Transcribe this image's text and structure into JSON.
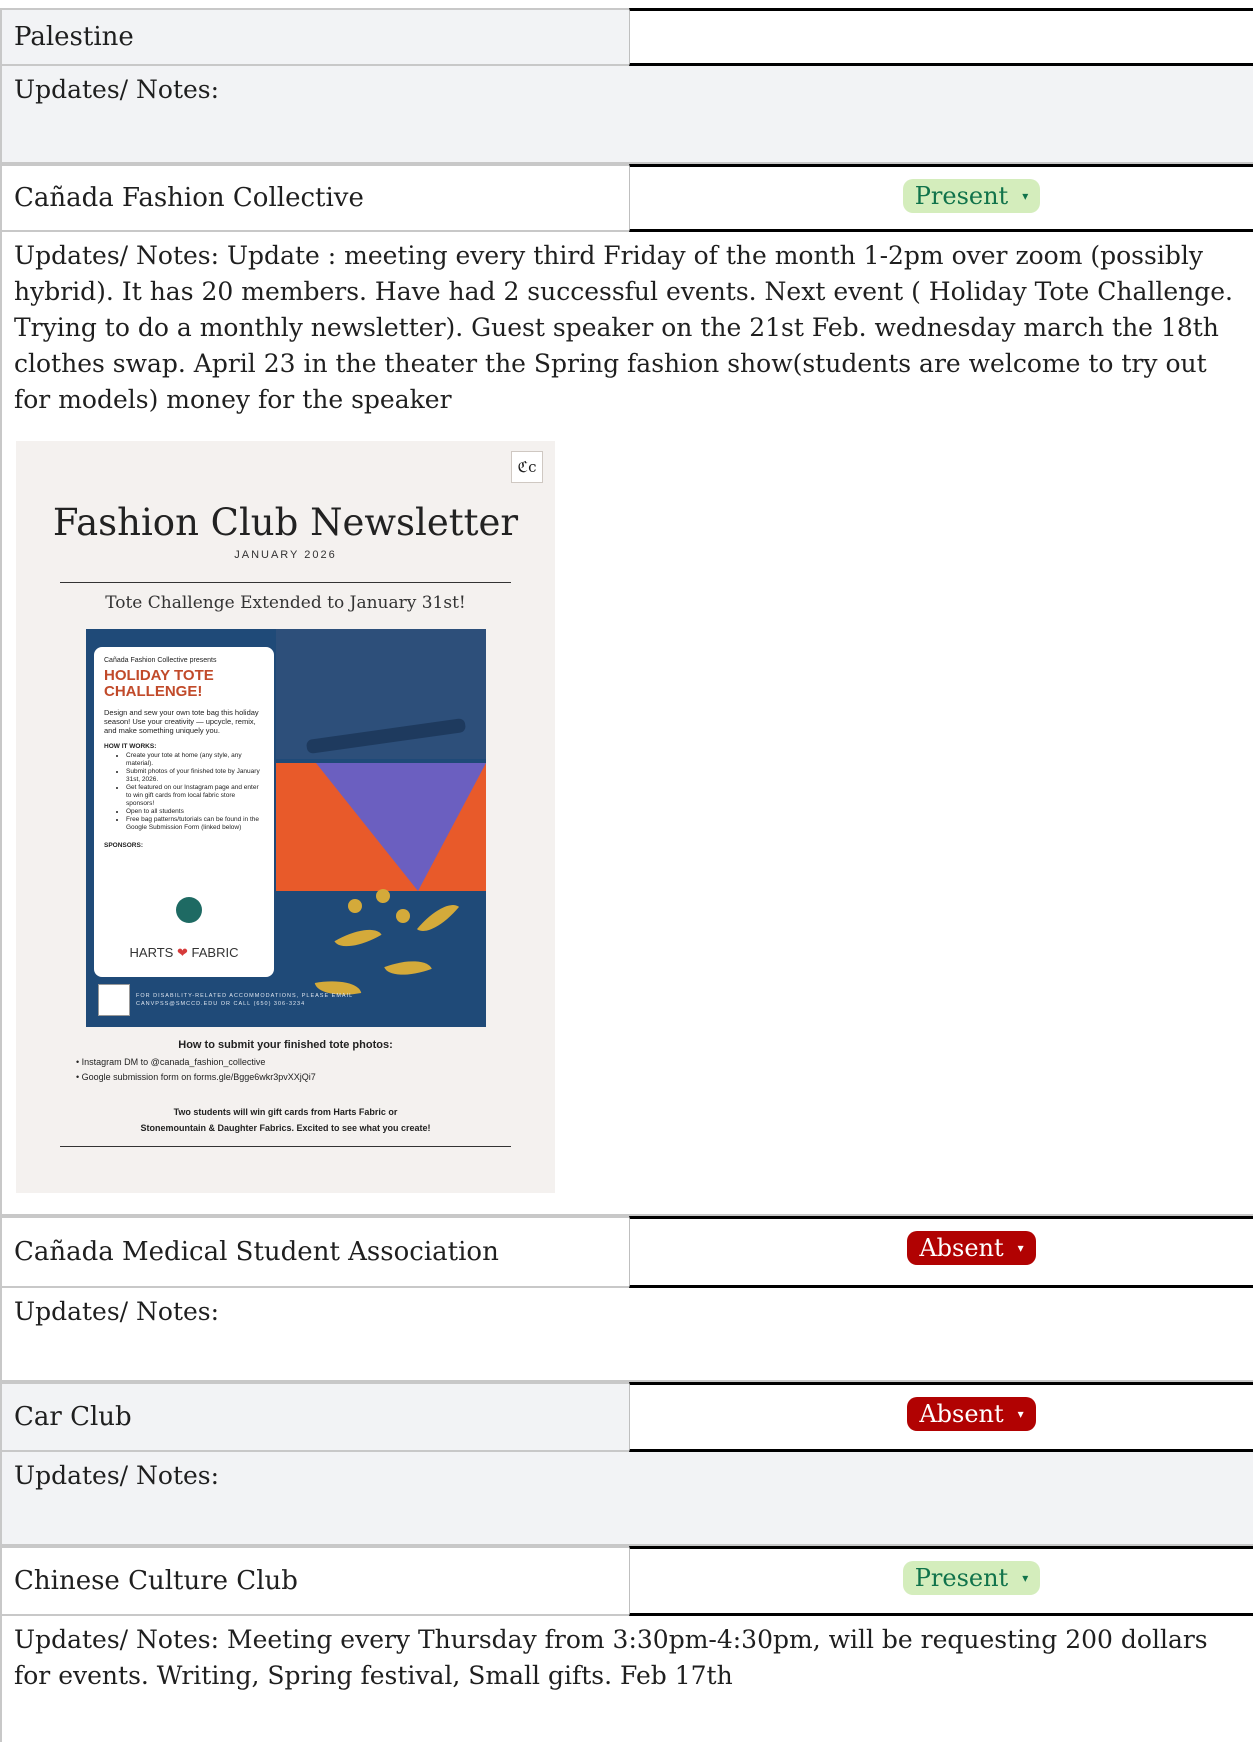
{
  "rows": [
    {
      "name": "Palestine",
      "notes": "Updates/ Notes:"
    },
    {
      "name": "Cañada Fashion Collective",
      "status": "Present",
      "notes": "Updates/ Notes: Update : meeting every third Friday of the month 1-2pm over zoom (possibly hybrid). It has 20 members. Have had 2 successful events. Next event ( Holiday Tote Challenge. Trying to do a monthly newsletter). Guest speaker on the 21st Feb. wednesday march the 18th clothes swap. April 23 in the theater the Spring fashion show(students are welcome to try out for models) money for the speaker"
    },
    {
      "name": "Cañada Medical Student Association",
      "status": "Absent",
      "notes": "Updates/ Notes:"
    },
    {
      "name": "Car Club",
      "status": "Absent",
      "notes": "Updates/ Notes:"
    },
    {
      "name": "Chinese Culture Club",
      "status": "Present",
      "notes": "Updates/ Notes: Meeting every Thursday from 3:30pm-4:30pm, will be requesting 200 dollars for events. Writing, Spring festival, Small gifts.  Feb 17th"
    }
  ],
  "dropdown_caret": "▾",
  "colors": {
    "present_bg": "#d4edbc",
    "present_text": "#11734b",
    "absent_bg": "#b10202",
    "absent_text": "#ffffff"
  },
  "newsletter": {
    "logo": "ℭc",
    "title": "Fashion Club Newsletter",
    "month": "JANUARY 2026",
    "subtitle": "Tote Challenge Extended to January 31st!",
    "card_pre": "Cañada Fashion Collective presents",
    "card_title": "HOLIDAY TOTE CHALLENGE!",
    "card_desc": "Design and sew your own tote bag this holiday season! Use your creativity — upcycle, remix, and make something uniquely you.",
    "how_label": "HOW IT WORKS:",
    "how_items": [
      "Create your tote at home (any style, any material).",
      "Submit photos of your finished tote by January 31st, 2026.",
      "Get featured on our Instagram page and enter to win gift cards from local fabric store sponsors!",
      "Open to all students",
      "Free bag patterns/tutorials can be found in the Google Submission Form (linked below)"
    ],
    "sponsors_label": "SPONSORS:",
    "sponsor_left": "HARTS",
    "sponsor_heart": "❤",
    "sponsor_right": "FABRIC",
    "footer_line1": "FOR DISABILITY-RELATED ACCOMMODATIONS, PLEASE EMAIL",
    "footer_line2": "CANVPSS@SMCCD.EDU OR CALL (650) 306-3234",
    "submit_heading": "How to submit your finished tote photos:",
    "submit_items": [
      "Instagram DM to @canada_fashion_collective",
      "Google submission form on forms.gle/Bgge6wkr3pvXXjQi7"
    ],
    "closing_line1": "Two students will win gift cards from Harts Fabric or",
    "closing_line2": "Stonemountain & Daughter Fabrics. Excited to see what you create!"
  }
}
